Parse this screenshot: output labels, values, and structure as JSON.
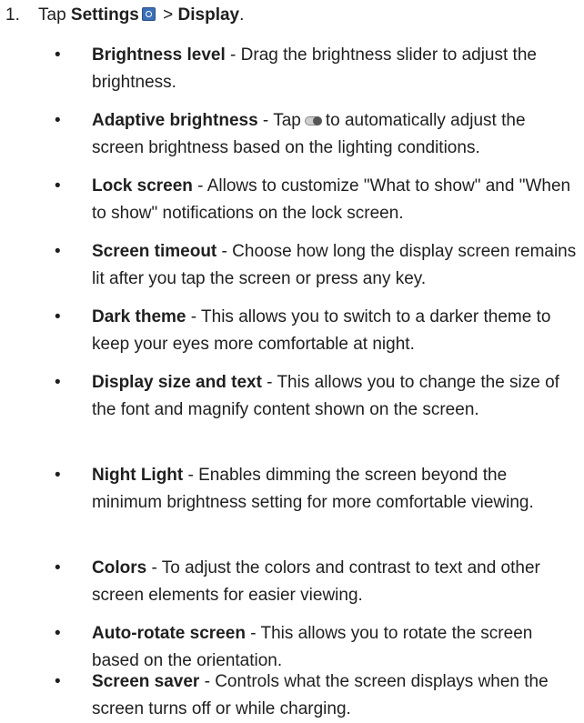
{
  "step": {
    "number": "1.",
    "prefix": "Tap ",
    "settings_label": "Settings",
    "separator": " > ",
    "display_label": "Display",
    "suffix": "."
  },
  "items": [
    {
      "title": "Brightness level",
      "pre": " - Drag the brightness slider to adjust the brightness.",
      "post": ""
    },
    {
      "title": "Adaptive brightness",
      "pre": " - Tap",
      "post": "to automatically adjust the screen brightness based on the lighting conditions."
    },
    {
      "title": "Lock screen",
      "pre": " - Allows to customize \"What to show\" and \"When to show\" notifications on the lock screen.",
      "post": ""
    },
    {
      "title": "Screen timeout",
      "pre": " - Choose how long the display screen remains lit after you tap the screen or press any key.",
      "post": ""
    },
    {
      "title": "Dark theme",
      "pre": " - This allows you to switch to a darker theme to keep your eyes more comfortable at night.",
      "post": ""
    },
    {
      "title": "Display size and text",
      "pre": " - This allows you to change the size of the font and magnify content shown on the screen.",
      "post": ""
    },
    {
      "title": "Night Light",
      "pre": " - Enables dimming the screen beyond the minimum brightness setting for more comfortable viewing.",
      "post": ""
    },
    {
      "title": "Colors",
      "pre": " - To adjust the colors and contrast to text and other screen elements for easier viewing.",
      "post": ""
    },
    {
      "title": "Auto-rotate screen",
      "pre": " - This allows you to rotate the screen based on the orientation.",
      "post": ""
    },
    {
      "title": "Screen saver",
      "pre": " - Controls what the screen displays when the screen turns off or while charging.",
      "post": ""
    }
  ],
  "bullet": "•",
  "icons": {
    "settings": "settings-icon",
    "toggle": "toggle-switch-icon"
  }
}
